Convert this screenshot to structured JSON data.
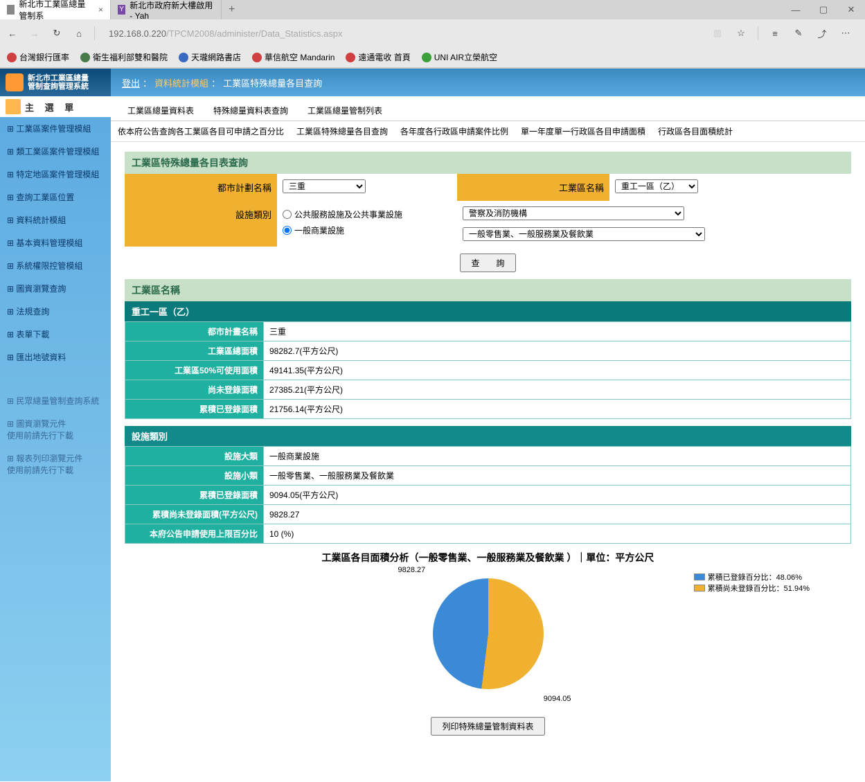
{
  "browser": {
    "tabs": [
      {
        "title": "新北市工業區總量管制系",
        "favicon": "#888"
      },
      {
        "title": "新北市政府新大樓啟用 - Yah",
        "favicon": "#7a4aa8"
      }
    ],
    "url_gray_prefix": "192.168.0.220",
    "url_rest": "/TPCM2008/administer/Data_Statistics.aspx",
    "bookmarks": [
      {
        "label": "台灣銀行匯率",
        "color": "#d04040"
      },
      {
        "label": "衛生福利部雙和醫院",
        "color": "#4a7a4a"
      },
      {
        "label": "天瓏網路書店",
        "color": "#3a6ac0"
      },
      {
        "label": "華信航空 Mandarin",
        "color": "#d04040"
      },
      {
        "label": "遠通電收 首頁",
        "color": "#d04040"
      },
      {
        "label": "UNI AIR立榮航空",
        "color": "#3aa03a"
      }
    ]
  },
  "app": {
    "logo_line1": "新北市工業區總量",
    "logo_line2": "管制查詢管理系統",
    "main_menu_title": "主 選 單",
    "menu": [
      "工業區案件管理模組",
      "類工業區案件管理模組",
      "特定地區案件管理模組",
      "查詢工業區位置",
      "資料統計模組",
      "基本資料管理模組",
      "系統權限控管模組",
      "圖資瀏覽查詢",
      "法規查詢",
      "表單下載",
      "匯出地號資料"
    ],
    "menu_extra": [
      "民眾總量管制查詢系統",
      "圖資瀏覽元件\n使用前請先行下載",
      "報表列印瀏覽元件\n使用前請先行下載"
    ]
  },
  "breadcrumb": {
    "logout": "登出",
    "sep": "：",
    "module": "資料統計模組",
    "page": "工業區特殊總量各目查詢"
  },
  "tabs_main": [
    "工業區總量資料表",
    "特殊總量資料表查詢",
    "工業區總量管制列表"
  ],
  "tabs_sub": [
    "依本府公告查詢各工業區各目可申請之百分比",
    "工業區特殊總量各目查詢",
    "各年度各行政區申請案件比例",
    "單一年度單一行政區各目申請面積",
    "行政區各目面積統計"
  ],
  "query": {
    "title": "工業區特殊總量各目表查詢",
    "plan_name_label": "都市計劃名稱",
    "plan_name_value": "三重",
    "zone_name_label": "工業區名稱",
    "zone_name_value": "重工一區（乙）",
    "facility_type_label": "設施類別",
    "radio1": "公共服務設施及公共事業設施",
    "radio2": "一般商業設施",
    "select1": "警察及消防機構",
    "select2": "一般零售業、一般服務業及餐飲業",
    "btn_query": "查　　詢"
  },
  "result": {
    "section1_title": "工業區名稱",
    "section1_subtitle": "重工一區（乙）",
    "rows1": [
      {
        "label": "都市計畫名稱",
        "value": "三重"
      },
      {
        "label": "工業區總面積",
        "value": "98282.7(平方公尺)"
      },
      {
        "label": "工業區50%可使用面積",
        "value": "49141.35(平方公尺)"
      },
      {
        "label": "尚未登錄面積",
        "value": "27385.21(平方公尺)"
      },
      {
        "label": "累積已登錄面積",
        "value": "21756.14(平方公尺)"
      }
    ],
    "section2_title": "設施類別",
    "rows2": [
      {
        "label": "設施大類",
        "value": "一般商業設施"
      },
      {
        "label": "設施小類",
        "value": "一般零售業、一般服務業及餐飲業"
      },
      {
        "label": "累積已登錄面積",
        "value": "9094.05(平方公尺)"
      },
      {
        "label": "累積尚未登錄面積(平方公尺)",
        "value": "9828.27"
      },
      {
        "label": "本府公告申請使用上限百分比",
        "value": "10 (%)"
      }
    ]
  },
  "chart_data": {
    "type": "pie",
    "title": "工業區各目面積分析（一般零售業、一般服務業及餐飲業 ）｜單位：平方公尺",
    "series": [
      {
        "name": "累積已登錄百分比",
        "value": 9094.05,
        "percent": 48.06,
        "color": "#3a8ad8"
      },
      {
        "name": "累積尚未登錄百分比",
        "value": 9828.27,
        "percent": 51.94,
        "color": "#f0b030"
      }
    ],
    "legend_items": [
      "累積已登錄百分比：48.06%",
      "累積尚未登錄百分比：51.94%"
    ],
    "label_top": "9828.27",
    "label_bottom": "9094.05"
  },
  "print_btn": "列印特殊總量管制資料表"
}
